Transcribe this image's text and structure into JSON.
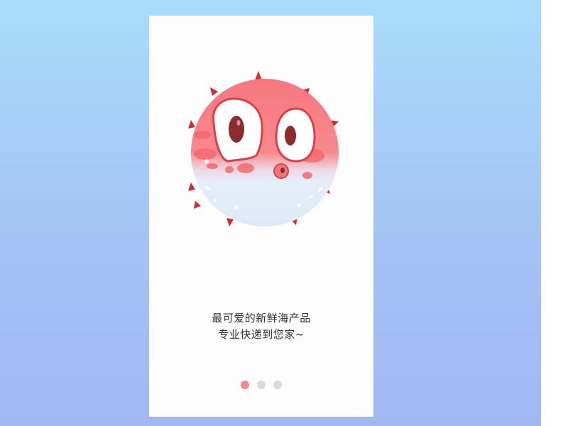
{
  "onboarding": {
    "slogan_line1": "最可爱的新鲜海产品",
    "slogan_line2": "专业快递到您家~",
    "illustration": "pufferfish-mascot",
    "pagination": {
      "count": 3,
      "active_index": 0
    }
  },
  "colors": {
    "background_top": "#a8dcfa",
    "background_bottom": "#a2b8f3",
    "card": "#fdfdfd",
    "accent": "#f08a8d",
    "dot_inactive": "#dadada",
    "text": "#333333"
  }
}
